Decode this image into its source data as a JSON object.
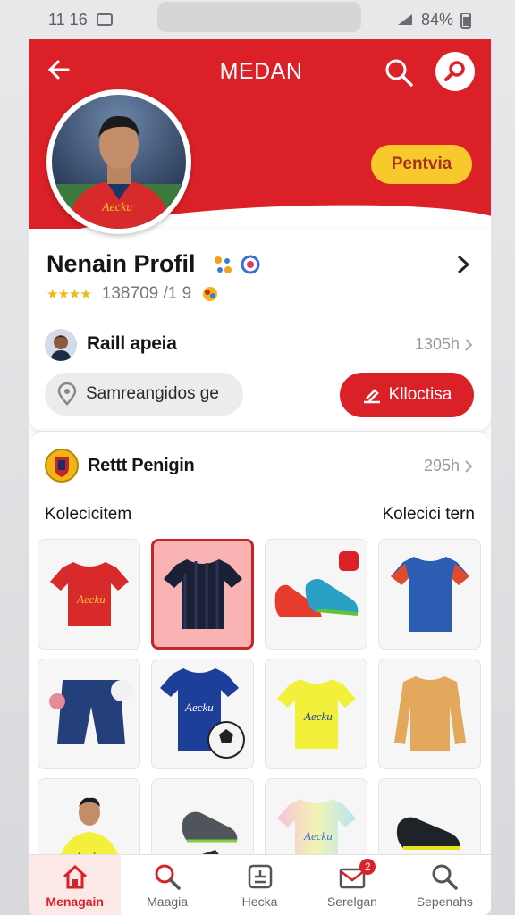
{
  "status_bar": {
    "time": "11 16",
    "battery": "84%"
  },
  "header": {
    "title": "MEDAN",
    "badge": "Pentvia"
  },
  "profile": {
    "name": "Nenain Profil",
    "rating_text": "138709 /1 9",
    "stars": "★★★★",
    "contact": {
      "name": "Raill apeia",
      "meta": "1305h"
    },
    "location": "Samreangidos ge",
    "action_button": "Klloctisa"
  },
  "shop": {
    "name": "Rettt Penigin",
    "meta": "295h",
    "section_left": "Kolecicitem",
    "section_right": "Kolecici tern",
    "items": [
      {
        "name": "red-jersey"
      },
      {
        "name": "dark-jersey"
      },
      {
        "name": "boots"
      },
      {
        "name": "blue-red-jersey"
      },
      {
        "name": "shorts"
      },
      {
        "name": "blue-jersey-ball"
      },
      {
        "name": "yellow-jersey"
      },
      {
        "name": "orange-jacket"
      },
      {
        "name": "player-yellow"
      },
      {
        "name": "grey-boots"
      },
      {
        "name": "pastel-jersey"
      },
      {
        "name": "black-boots"
      }
    ]
  },
  "nav": [
    {
      "label": "Menagain",
      "icon": "home-icon",
      "active": true
    },
    {
      "label": "Maagia",
      "icon": "search-icon",
      "active": false
    },
    {
      "label": "Hecka",
      "icon": "box-icon",
      "active": false
    },
    {
      "label": "Serelgan",
      "icon": "mail-icon",
      "active": false,
      "badge": "2"
    },
    {
      "label": "Sepenahs",
      "icon": "search-icon",
      "active": false
    }
  ],
  "colors": {
    "brand": "#db2127",
    "accent": "#f7c92d"
  }
}
